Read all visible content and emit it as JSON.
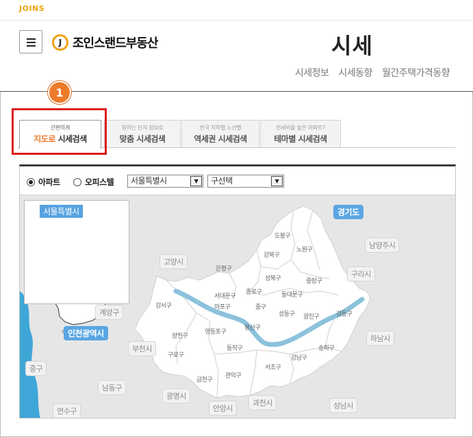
{
  "topbar": {
    "logo": "JOINS"
  },
  "header": {
    "brand_mark": "J",
    "brand_name": "조인스랜드부동산",
    "page_title": "시세",
    "subnav": [
      "시세정보",
      "시세동향",
      "월간주택가격동향"
    ]
  },
  "step_badge": "1",
  "tabs": [
    {
      "small": "간편하게",
      "big_accent": "지도로",
      "big": " 시세검색",
      "active": true
    },
    {
      "small": "원하는 단지 정보로",
      "big_accent": "",
      "big": "맞춤 시세검색",
      "active": false
    },
    {
      "small": "전국 지하철 노선별",
      "big_accent": "",
      "big": "역세권 시세검색",
      "active": false
    },
    {
      "small": "전세비율 높은 아파트?",
      "big_accent": "",
      "big": "테마별 시세검색",
      "active": false
    }
  ],
  "filters": {
    "radio_apartment": "아파트",
    "radio_office": "오피스텔",
    "selected_radio": "apartment",
    "city_select": "서울특별시",
    "district_select": "구선택",
    "dropdown_glyph": "▼"
  },
  "map": {
    "inset_label": "서울특별시",
    "regions": {
      "gyeonggi": "경기도",
      "incheon": "인천광역시"
    },
    "outer_areas": [
      "고양시",
      "남양주시",
      "구리시",
      "계양구",
      "부천시",
      "하남시",
      "중구",
      "남동구",
      "광명시",
      "안양시",
      "과천시",
      "성남시",
      "연수구"
    ],
    "gu": [
      "도봉구",
      "노원구",
      "강북구",
      "은평구",
      "성북구",
      "중랑구",
      "종로구",
      "서대문구",
      "동대문구",
      "마포구",
      "중구",
      "강서구",
      "성동구",
      "광진구",
      "강동구",
      "용산구",
      "양천구",
      "영등포구",
      "동작구",
      "구로구",
      "송파구",
      "강남구",
      "서초구",
      "금천구",
      "관악구"
    ],
    "colors": {
      "sea": "#3fa6d8",
      "land": "#e6e6e6",
      "seoul": "#ffffff",
      "river": "#7fb9d6",
      "accent": "#ee7b2b",
      "highlight_box": "#dd1c1c"
    }
  }
}
